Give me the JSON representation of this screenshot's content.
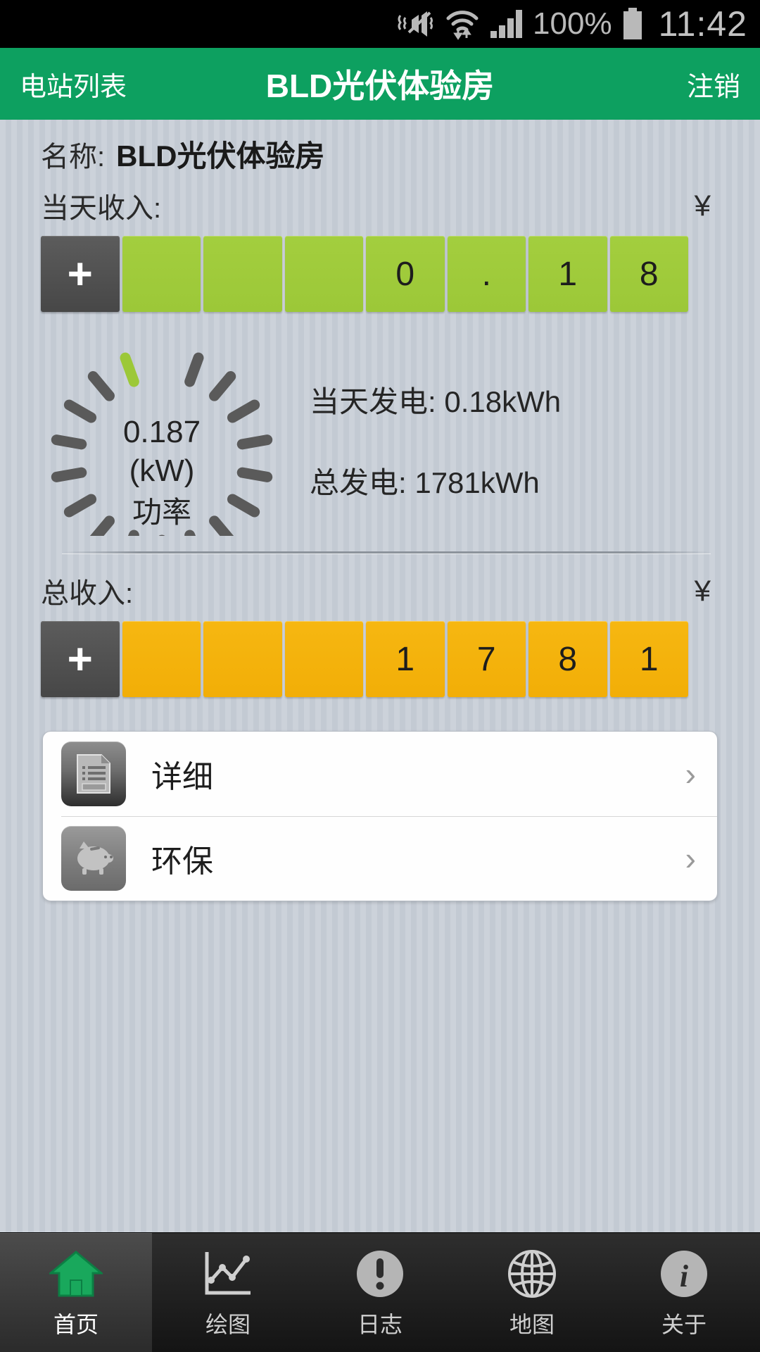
{
  "status_bar": {
    "battery_percent": "100%",
    "time": "11:42",
    "icons": [
      "vibrate-mute-icon",
      "wifi-data-icon",
      "signal-bars-icon",
      "battery-icon"
    ]
  },
  "action_bar": {
    "back_label": "电站列表",
    "title": "BLD光伏体验房",
    "logout_label": "注销"
  },
  "plant": {
    "name_label": "名称:",
    "name_value": "BLD光伏体验房"
  },
  "today_income": {
    "label": "当天收入:",
    "currency": "¥",
    "plus": "+",
    "cells": [
      "",
      "",
      "",
      "0",
      ".",
      "1",
      "8"
    ]
  },
  "gauge": {
    "value": "0.187",
    "unit": "(kW)",
    "name": "功率",
    "active_ticks": 1,
    "total_ticks": 17,
    "active_color": "#9cc838",
    "inactive_color": "#5a5a5a"
  },
  "stats": {
    "today_generation": "当天发电: 0.18kWh",
    "total_generation": "总发电: 1781kWh"
  },
  "total_income": {
    "label": "总收入:",
    "currency": "¥",
    "plus": "+",
    "cells": [
      "",
      "",
      "",
      "1",
      "7",
      "8",
      "1"
    ]
  },
  "list": {
    "items": [
      {
        "label": "详细",
        "icon": "document-icon",
        "chevron": "›"
      },
      {
        "label": "环保",
        "icon": "piggy-bank-icon",
        "chevron": "›"
      }
    ]
  },
  "tabbar": {
    "items": [
      {
        "label": "首页",
        "icon": "home-icon",
        "active": true
      },
      {
        "label": "绘图",
        "icon": "line-chart-icon",
        "active": false
      },
      {
        "label": "日志",
        "icon": "exclamation-circle-icon",
        "active": false
      },
      {
        "label": "地图",
        "icon": "globe-icon",
        "active": false
      },
      {
        "label": "关于",
        "icon": "info-circle-icon",
        "active": false
      }
    ]
  },
  "colors": {
    "accent_green": "#0da060",
    "digit_green": "#9cc838",
    "digit_orange": "#f2ae07",
    "background": "#c9d0d8"
  }
}
